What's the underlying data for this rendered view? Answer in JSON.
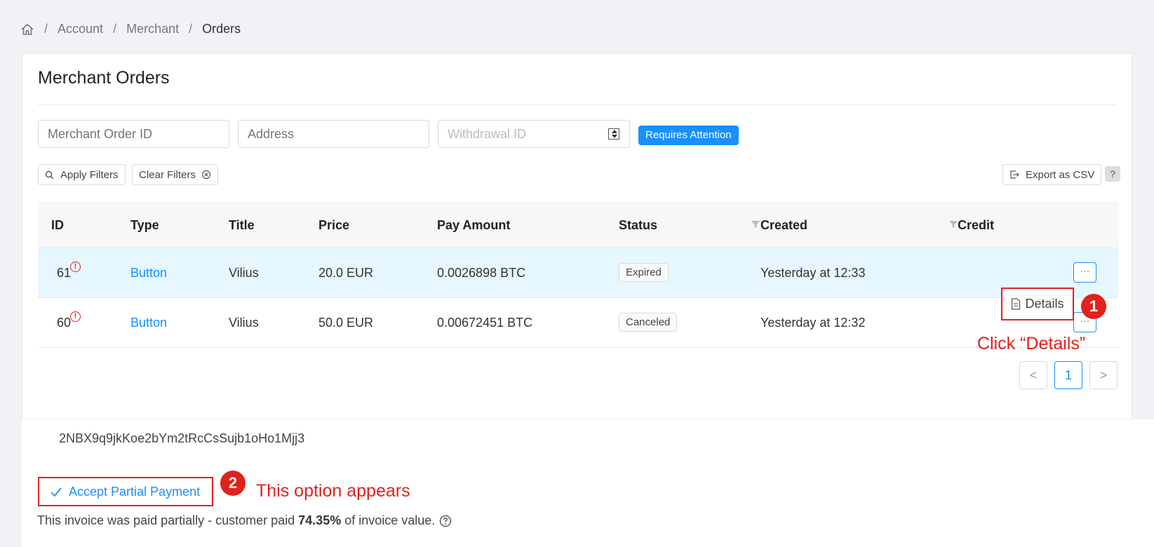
{
  "breadcrumb": {
    "items": [
      "Account",
      "Merchant"
    ],
    "current": "Orders",
    "separator": "/"
  },
  "page": {
    "title": "Merchant Orders"
  },
  "filters": {
    "merchant_order_placeholder": "Merchant Order ID",
    "address_placeholder": "Address",
    "withdrawal_placeholder": "Withdrawal ID",
    "requires_attention": "Requires Attention",
    "apply_label": "Apply Filters",
    "clear_label": "Clear Filters",
    "export_label": "Export as CSV",
    "help_label": "?"
  },
  "table": {
    "headers": [
      "ID",
      "Type",
      "Title",
      "Price",
      "Pay Amount",
      "Status",
      "Created",
      "Credit"
    ],
    "rows": [
      {
        "id": "61",
        "type": "Button",
        "title": "Vilius",
        "price": "20.0 EUR",
        "pay_amount": "0.0026898 BTC",
        "status": "Expired",
        "created": "Yesterday at 12:33"
      },
      {
        "id": "60",
        "type": "Button",
        "title": "Vilius",
        "price": "50.0 EUR",
        "pay_amount": "0.00672451 BTC",
        "status": "Canceled",
        "created": "Yesterday at 12:32"
      }
    ],
    "more_label": "···",
    "warn_glyph": "!"
  },
  "pagination": {
    "prev": "<",
    "current": "1",
    "next": ">"
  },
  "dropdown": {
    "details_label": "Details"
  },
  "annotations": {
    "step1_number": "1",
    "step1_text": "Click “Details”",
    "step2_number": "2",
    "step2_text": "This option appears"
  },
  "details_panel": {
    "address": "2NBX9q9jkKoe2bYm2tRcCsSujb1oHo1Mjj3",
    "accept_label": "Accept Partial Payment",
    "partial_prefix": "This invoice was paid partially - customer paid",
    "partial_percent": "74.35%",
    "partial_suffix": "of invoice value."
  },
  "colors": {
    "accent": "#1890ff",
    "annotation_red": "#e0221c",
    "row_highlight": "#e6f7ff"
  }
}
